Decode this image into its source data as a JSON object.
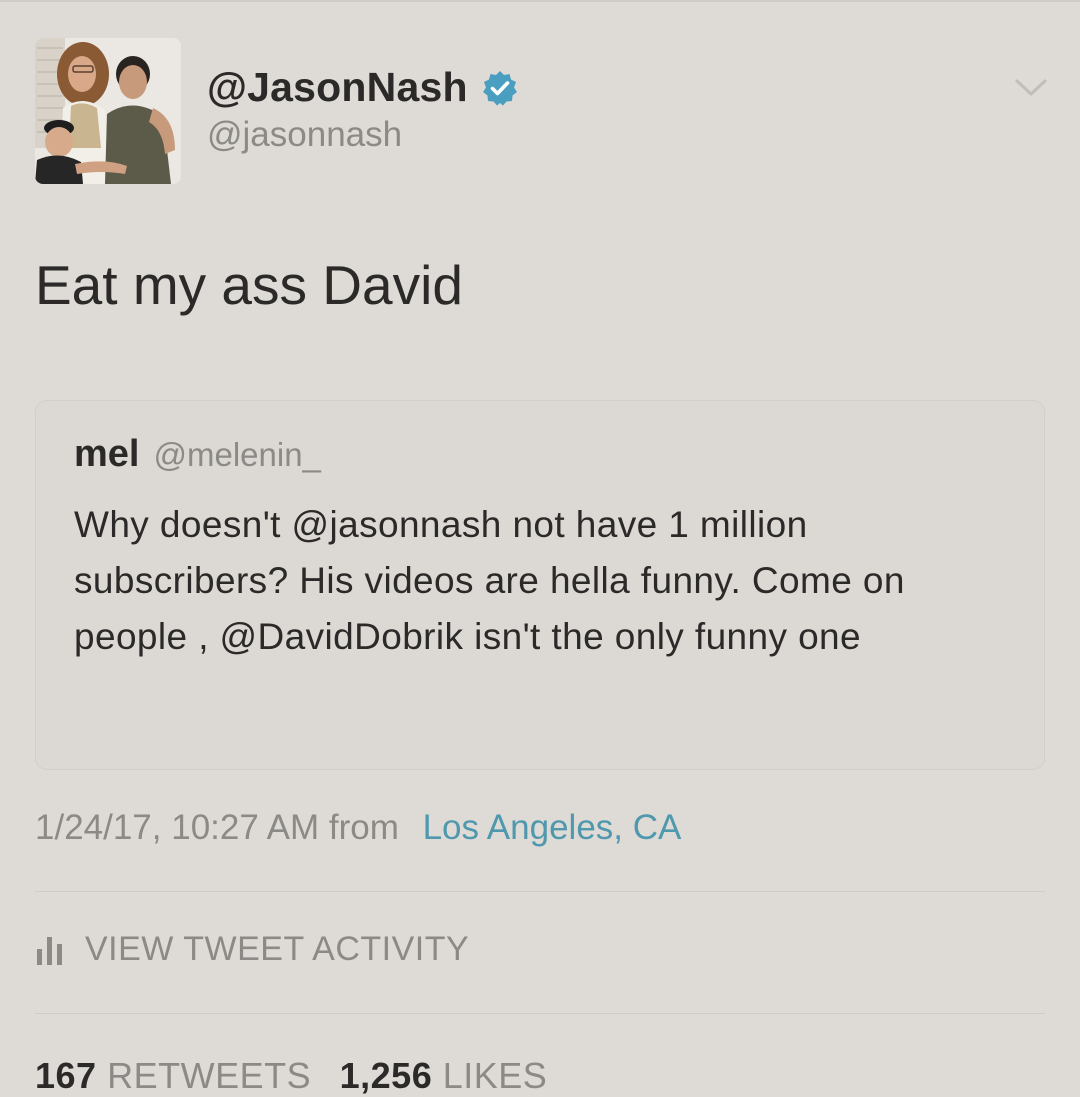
{
  "tweet": {
    "display_name": "@JasonNash",
    "handle": "@jasonnash",
    "verified": true,
    "text": "Eat my ass David",
    "timestamp": "1/24/17, 10:27 AM",
    "from_label": "from",
    "location": "Los Angeles, CA"
  },
  "quoted_tweet": {
    "name": "mel",
    "handle": "@melenin_",
    "text": "Why doesn't @jasonnash not have 1 million subscribers? His videos are hella funny. Come on people , @DavidDobrik isn't the only funny one"
  },
  "actions": {
    "view_activity": "VIEW TWEET ACTIVITY"
  },
  "stats": {
    "retweets_count": "167",
    "retweets_label": "RETWEETS",
    "likes_count": "1,256",
    "likes_label": "LIKES"
  },
  "colors": {
    "background": "#dedbd6",
    "text": "#2b2a29",
    "muted": "#8c8a87",
    "link": "#4f98ad",
    "verified_badge": "#4a9fc0"
  },
  "icons": {
    "verified": "verified-badge-icon",
    "caret": "chevron-down-icon",
    "activity": "bar-chart-icon"
  }
}
